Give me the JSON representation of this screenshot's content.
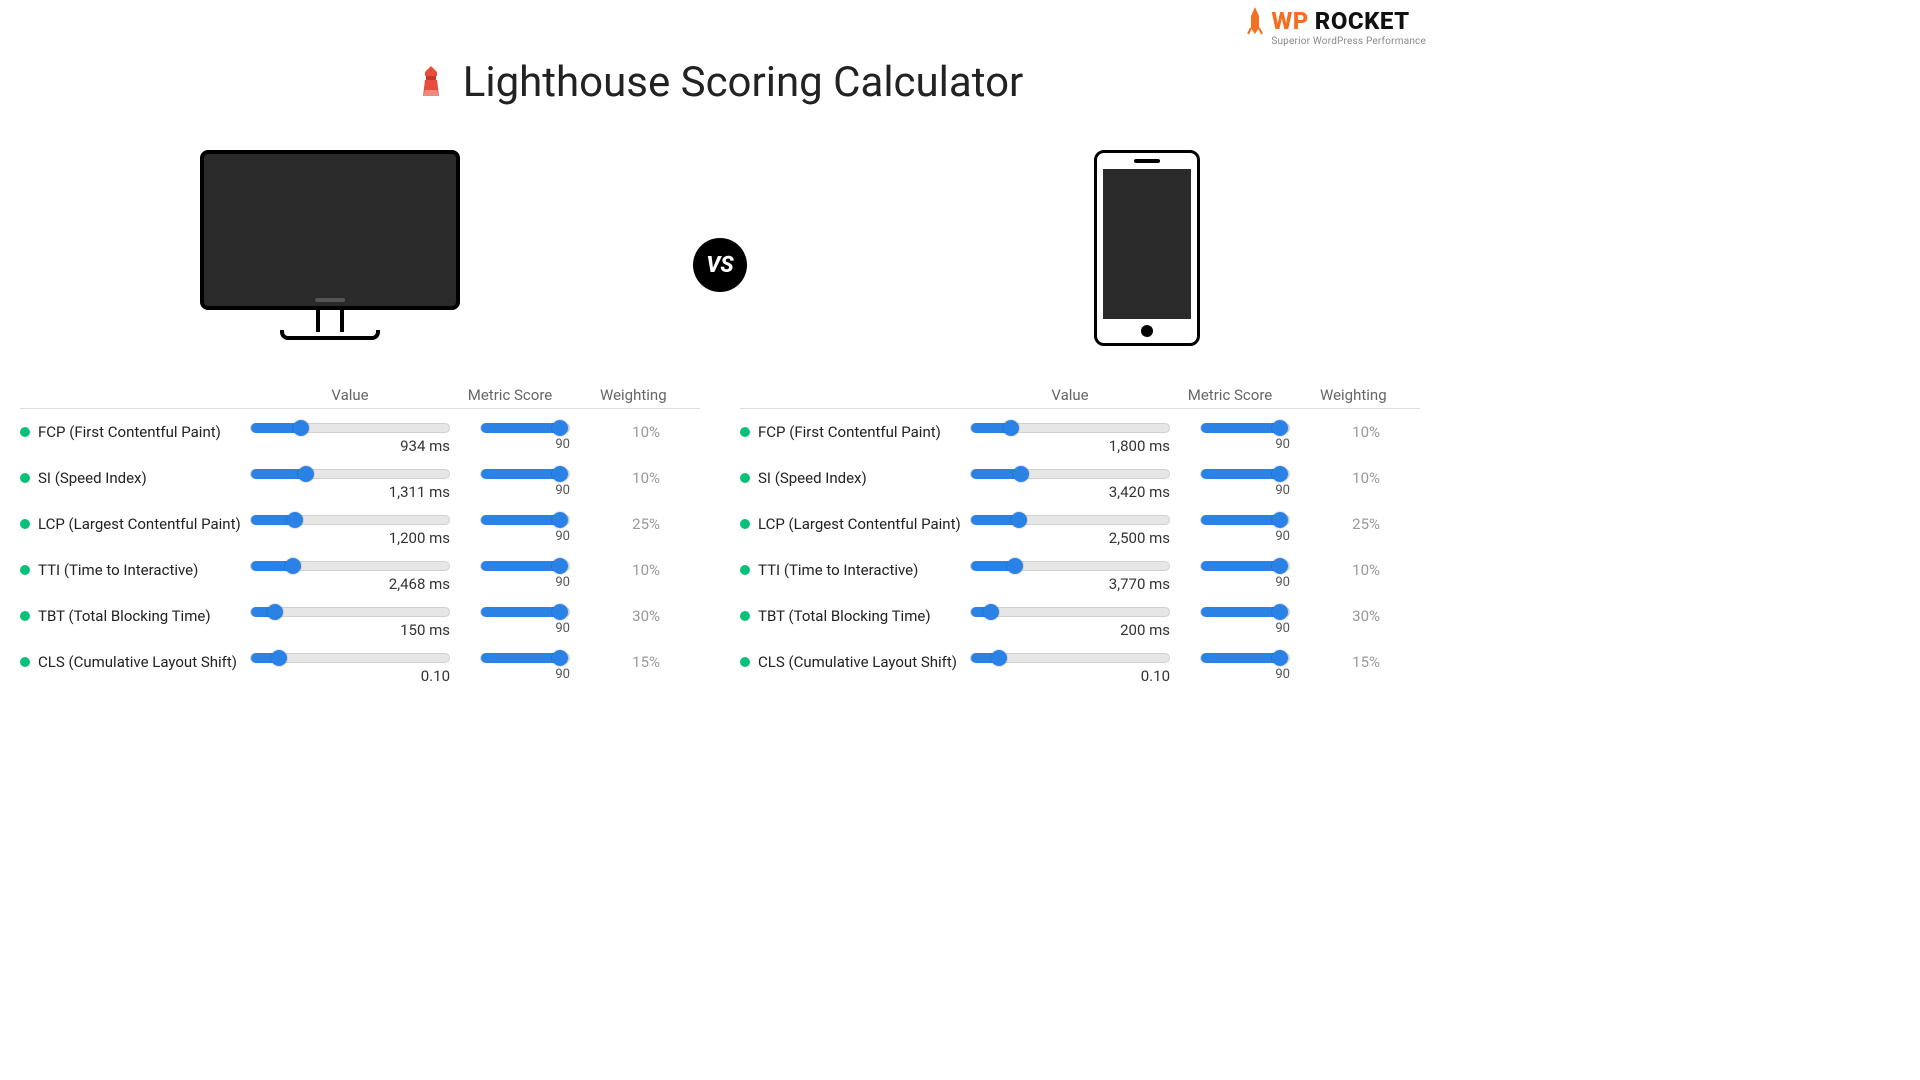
{
  "brand": {
    "wp": "WP",
    "rocket": "ROCKET",
    "tagline": "Superior WordPress Performance"
  },
  "title": "Lighthouse Scoring Calculator",
  "vs": "VS",
  "columns": {
    "value": "Value",
    "score": "Metric Score",
    "weight": "Weighting"
  },
  "desktop": {
    "metrics": [
      {
        "label": "FCP (First Contentful Paint)",
        "value": "934 ms",
        "valuePct": 25,
        "score": "90",
        "scorePct": 90,
        "weight": "10%"
      },
      {
        "label": "SI (Speed Index)",
        "value": "1,311 ms",
        "valuePct": 28,
        "score": "90",
        "scorePct": 90,
        "weight": "10%"
      },
      {
        "label": "LCP (Largest Contentful Paint)",
        "value": "1,200 ms",
        "valuePct": 22,
        "score": "90",
        "scorePct": 90,
        "weight": "25%"
      },
      {
        "label": "TTI (Time to Interactive)",
        "value": "2,468 ms",
        "valuePct": 21,
        "score": "90",
        "scorePct": 90,
        "weight": "10%"
      },
      {
        "label": "TBT (Total Blocking Time)",
        "value": "150 ms",
        "valuePct": 12,
        "score": "90",
        "scorePct": 90,
        "weight": "30%"
      },
      {
        "label": "CLS (Cumulative Layout Shift)",
        "value": "0.10",
        "valuePct": 14,
        "score": "90",
        "scorePct": 90,
        "weight": "15%"
      }
    ]
  },
  "mobile": {
    "metrics": [
      {
        "label": "FCP (First Contentful Paint)",
        "value": "1,800 ms",
        "valuePct": 20,
        "score": "90",
        "scorePct": 90,
        "weight": "10%"
      },
      {
        "label": "SI (Speed Index)",
        "value": "3,420 ms",
        "valuePct": 25,
        "score": "90",
        "scorePct": 90,
        "weight": "10%"
      },
      {
        "label": "LCP (Largest Contentful Paint)",
        "value": "2,500 ms",
        "valuePct": 24,
        "score": "90",
        "scorePct": 90,
        "weight": "25%"
      },
      {
        "label": "TTI (Time to Interactive)",
        "value": "3,770 ms",
        "valuePct": 22,
        "score": "90",
        "scorePct": 90,
        "weight": "10%"
      },
      {
        "label": "TBT (Total Blocking Time)",
        "value": "200 ms",
        "valuePct": 10,
        "score": "90",
        "scorePct": 90,
        "weight": "30%"
      },
      {
        "label": "CLS (Cumulative Layout Shift)",
        "value": "0.10",
        "valuePct": 14,
        "score": "90",
        "scorePct": 90,
        "weight": "15%"
      }
    ]
  }
}
